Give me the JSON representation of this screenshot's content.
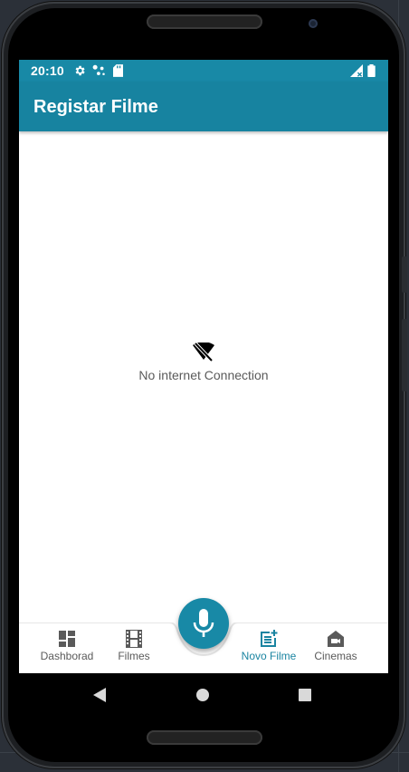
{
  "status_bar": {
    "time": "20:10",
    "icons": [
      "gear-icon",
      "network-dots-icon",
      "sd-card-icon",
      "signal-icon",
      "battery-icon"
    ]
  },
  "app_bar": {
    "title": "Registar Filme"
  },
  "content": {
    "icon": "wifi-off-icon",
    "message": "No internet Connection"
  },
  "bottom_nav": {
    "items": [
      {
        "label": "Dashborad",
        "icon": "dashboard-icon",
        "active": false
      },
      {
        "label": "Filmes",
        "icon": "film-icon",
        "active": false
      },
      {
        "label": "Novo Filme",
        "icon": "post-add-icon",
        "active": true
      },
      {
        "label": "Cinemas",
        "icon": "cinema-icon",
        "active": false
      }
    ],
    "fab_icon": "microphone-icon"
  },
  "system_nav": {
    "buttons": [
      "back-icon",
      "home-icon",
      "recents-icon"
    ]
  },
  "colors": {
    "primary": "#1889a6",
    "app_bar": "#1783a0",
    "nav_inactive": "#5a5a5a",
    "nav_active": "#1a84a1"
  }
}
